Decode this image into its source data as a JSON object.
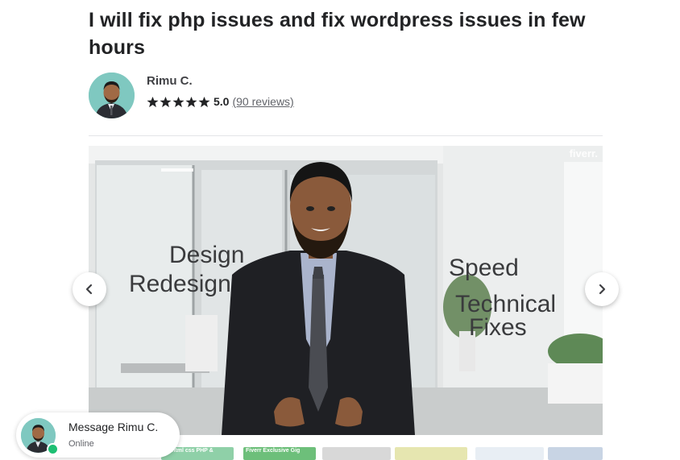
{
  "gig": {
    "title": "I will fix php issues and fix wordpress issues in few hours"
  },
  "seller": {
    "name": "Rimu C.",
    "rating": "5.0",
    "reviews_label": "(90 reviews)",
    "stars": 5
  },
  "gallery": {
    "watermark": "fiverr.",
    "overlay": {
      "design": "Design",
      "redesign": "Redesign",
      "speed": "Speed",
      "technical": "Technical",
      "fixes": "Fixes"
    },
    "thumbnails": [
      {
        "caption": "fix html css PHP &",
        "color": "#8fd0a8"
      },
      {
        "caption": "Fiverr Exclusive Gig",
        "color": "#6dbf7a"
      },
      {
        "caption": "",
        "color": "#d8d8d8"
      },
      {
        "caption": "",
        "color": "#e6e6b0"
      },
      {
        "caption": "",
        "color": "#e8eef4"
      },
      {
        "caption": "",
        "color": "#c8d4e4"
      }
    ]
  },
  "chat": {
    "title": "Message Rimu C.",
    "status": "Online"
  },
  "colors": {
    "online": "#1dbf73",
    "avatar_bg": "#7fc8c0"
  }
}
